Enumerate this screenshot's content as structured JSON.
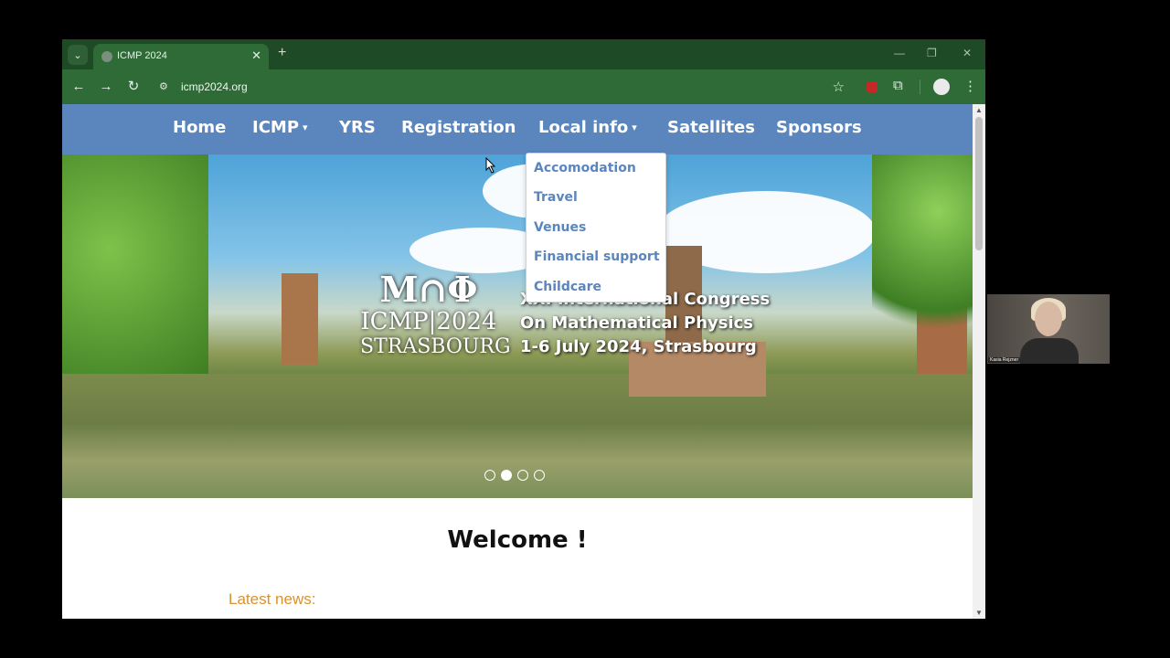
{
  "browser": {
    "tab_title": "ICMP 2024",
    "url": "icmp2024.org",
    "icons": {
      "tab_search": "chevron-down-icon",
      "close": "close-icon",
      "new_tab": "plus-icon",
      "back": "arrow-left-icon",
      "forward": "arrow-right-icon",
      "reload": "reload-icon",
      "site_info": "site-info-icon",
      "bookmark": "star-icon",
      "extensions": "puzzle-icon",
      "menu": "kebab-icon"
    },
    "glyphs": {
      "tab_search": "⌄",
      "close": "✕",
      "new_tab": "+",
      "back": "←",
      "forward": "→",
      "reload": "↻",
      "site_info": "⚙",
      "bookmark": "☆",
      "extensions": "⧉",
      "menu": "⋮",
      "minimize": "—",
      "restore": "❐",
      "window_close": "✕"
    }
  },
  "site_nav": {
    "items": [
      {
        "label": "Home",
        "active": true
      },
      {
        "label": "ICMP",
        "has_caret": true
      },
      {
        "label": "YRS"
      },
      {
        "label": "Registration"
      },
      {
        "label": "Local info",
        "has_caret": true
      },
      {
        "label": "Satellites"
      },
      {
        "label": "Sponsors"
      }
    ],
    "caret": "▾"
  },
  "dropdown": {
    "items": [
      "Accomodation",
      "Travel",
      "Venues",
      "Financial support",
      "Childcare"
    ]
  },
  "hero": {
    "logo_symbols": "M∩Φ",
    "logo_event": "ICMP|2024",
    "logo_city": "STRASBOURG",
    "lines": [
      "XXI International Congress",
      "On Mathematical Physics",
      "1-6 July 2024, Strasbourg"
    ],
    "carousel": {
      "count": 4,
      "active_index": 1
    }
  },
  "content": {
    "welcome": "Welcome !",
    "latest_news": "Latest news:"
  },
  "webcam": {
    "name": "Kasia Rejzner"
  },
  "colors": {
    "tab_bar": "#1f4a26",
    "toolbar": "#2f6b37",
    "site_nav": "#5b86bd",
    "dropdown_text": "#5b86bd",
    "latest_news": "#d9922e"
  }
}
